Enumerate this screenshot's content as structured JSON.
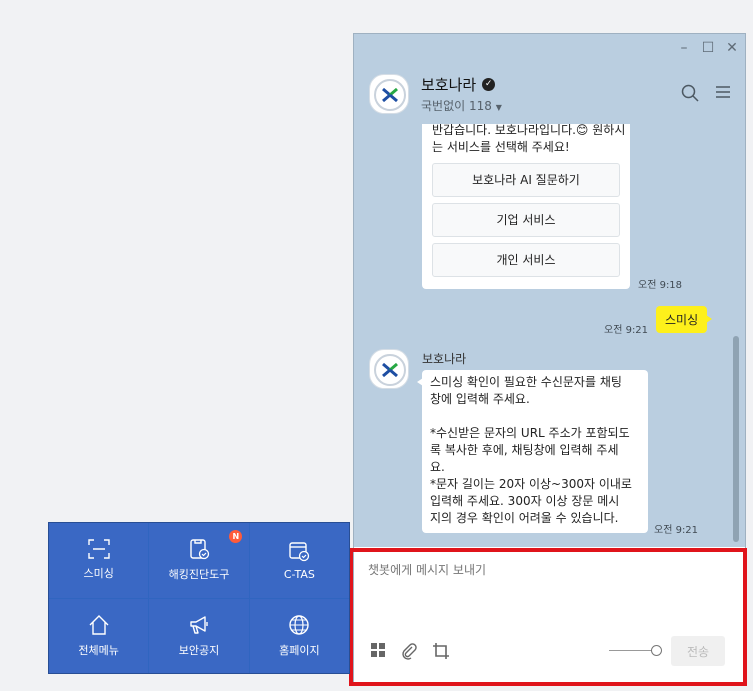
{
  "chat": {
    "room_name": "보호나라",
    "room_subtitle": "국번없이 118",
    "input_placeholder": "챗봇에게 메시지 보내기",
    "send_label": "전송",
    "messages": {
      "greeting_line1": "반갑습니다. 보호나라입니다.😊 원하시",
      "greeting_line2": "는 서비스를 선택해 주세요!",
      "options": [
        "보호나라 AI 질문하기",
        "기업 서비스",
        "개인 서비스"
      ],
      "greeting_time": "오전 9:18",
      "user_msg": "스미싱",
      "user_time": "오전 9:21",
      "bot_sender": "보호나라",
      "reply_lines": [
        "스미싱 확인이 필요한 수신문자를 채팅",
        "창에 입력해 주세요.",
        "",
        "*수신받은 문자의 URL 주소가 포함되도",
        "록 복사한 후에, 채팅창에 입력해 주세",
        "요.",
        "*문자 길이는 20자 이상~300자 이내로",
        " 입력해 주세요. 300자 이상 장문 메시",
        "지의 경우 확인이 어려울 수 있습니다."
      ],
      "reply_time": "오전 9:21"
    }
  },
  "quick_menu": {
    "items": [
      {
        "label": "스미싱",
        "icon": "scan-icon"
      },
      {
        "label": "해킹진단도구",
        "icon": "clipboard-check-icon",
        "badge": "N"
      },
      {
        "label": "C-TAS",
        "icon": "window-check-icon"
      },
      {
        "label": "전체메뉴",
        "icon": "home-icon"
      },
      {
        "label": "보안공지",
        "icon": "megaphone-icon"
      },
      {
        "label": "홈페이지",
        "icon": "globe-icon"
      }
    ]
  },
  "colors": {
    "chat_bg": "#bacee0",
    "user_bubble": "#fef01b",
    "menu_bg": "#3a68c4",
    "highlight": "#e0141b"
  }
}
